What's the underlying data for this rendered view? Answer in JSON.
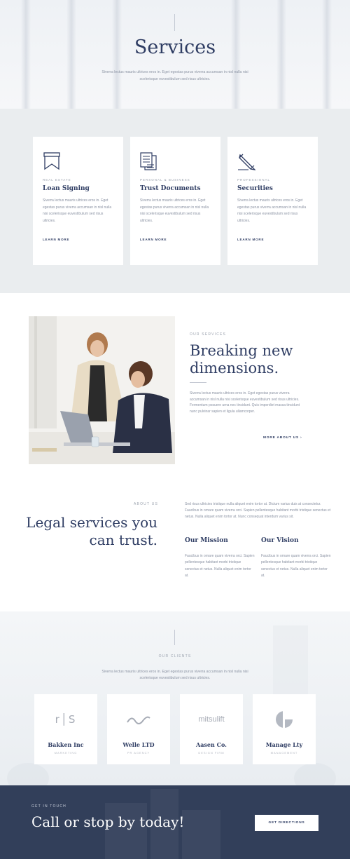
{
  "hero": {
    "title": "Services",
    "text": "Siverra lectus mauris ultrices eros in. Eget egestas purus viverra accumsan in nisl nulla nisi scelerisque euvestibulum sed risus ultricies."
  },
  "services": [
    {
      "icon": "bookmark-ribbon-icon",
      "tag": "Real Estate",
      "title": "Loan Signing",
      "text": "Siverra lectus mauris ultrices eros in. Eget egestas purus viverra accumsan in nisl nulla nisi scelerisque euvestibulum sed risus ultricies.",
      "link": "LEARN MORE"
    },
    {
      "icon": "documents-icon",
      "tag": "Personal & Business",
      "title": "Trust Documents",
      "text": "Siverra lectus mauris ultrices eros in. Eget egestas purus viverra accumsan in nisl nulla nisi scelerisque euvestibulum sed risus ultricies.",
      "link": "LEARN MORE"
    },
    {
      "icon": "pencil-icon",
      "tag": "Professional",
      "title": "Securities",
      "text": "Siverra lectus mauris ultrices eros in. Eget egestas purus viverra accumsan in nisl nulla nisi scelerisque euvestibulum sed risus ultricies.",
      "link": "LEARN MORE"
    }
  ],
  "feature": {
    "eyebrow": "OUR SERVICES",
    "title": "Breaking new dimensions.",
    "text": "Siverra lectus mauris ultrices eros in. Eget egestas purus viverra accumsan in nisl nulla nisi scelerisque euvestibulum sed risus ultricies. Fermentum posuere urna nec tincidunt. Quis imperdiet massa tincidunt nunc pulvinar sapien et ligula ullamcorper.",
    "more": "MORE ABOUT US ›"
  },
  "about": {
    "eyebrow": "ABOUT US",
    "title": "Legal services you can trust.",
    "intro": "Sed risus ultricies tristique nulla aliquet enim tortor at. Dictum varius duis at consectetur. Faucibus in ornare quam viverra orci. Sapien pellentesque habitant morbi tristique senectus et netus. Nulla aliquet enim tortor at. Nunc consequat interdum varius sit.",
    "mission_title": "Our Mission",
    "mission_text": "Faucibus in ornare quam viverra orci. Sapien pellentesque habitant morbi tristique senectus et netus. Nulla aliquet enim tortor at.",
    "vision_title": "Our Vision",
    "vision_text": "Faucibus in ornare quam viverra orci. Sapien pellentesque habitant morbi tristique senectus et netus. Nulla aliquet enim tortor at."
  },
  "clients": {
    "eyebrow": "OUR CLIENTS",
    "text": "Siverra lectus mauris ultrices eros in. Eget egestas purus viverra accumsan in nisl nulla nisi scelerisque euvestibulum sed risus ultricies.",
    "items": [
      {
        "logo_text": "r│S",
        "name": "Bakken Inc",
        "sub": "MARKETING"
      },
      {
        "logo_text": "",
        "name": "Welle LTD",
        "sub": "PR AGENCY"
      },
      {
        "logo_text": "mitsulift",
        "name": "Aasen Co.",
        "sub": "DESIGN FIRM"
      },
      {
        "logo_text": "",
        "name": "Manage Lty",
        "sub": "MANAGEMENT"
      }
    ]
  },
  "contact": {
    "eyebrow": "GET IN TOUCH",
    "title": "Call or stop by today!",
    "button": "GET DIRECTIONS"
  },
  "colors": {
    "primary": "#2f3d63",
    "muted": "#8a92a2",
    "panel": "#eaedef",
    "footer": "#323f5a"
  }
}
